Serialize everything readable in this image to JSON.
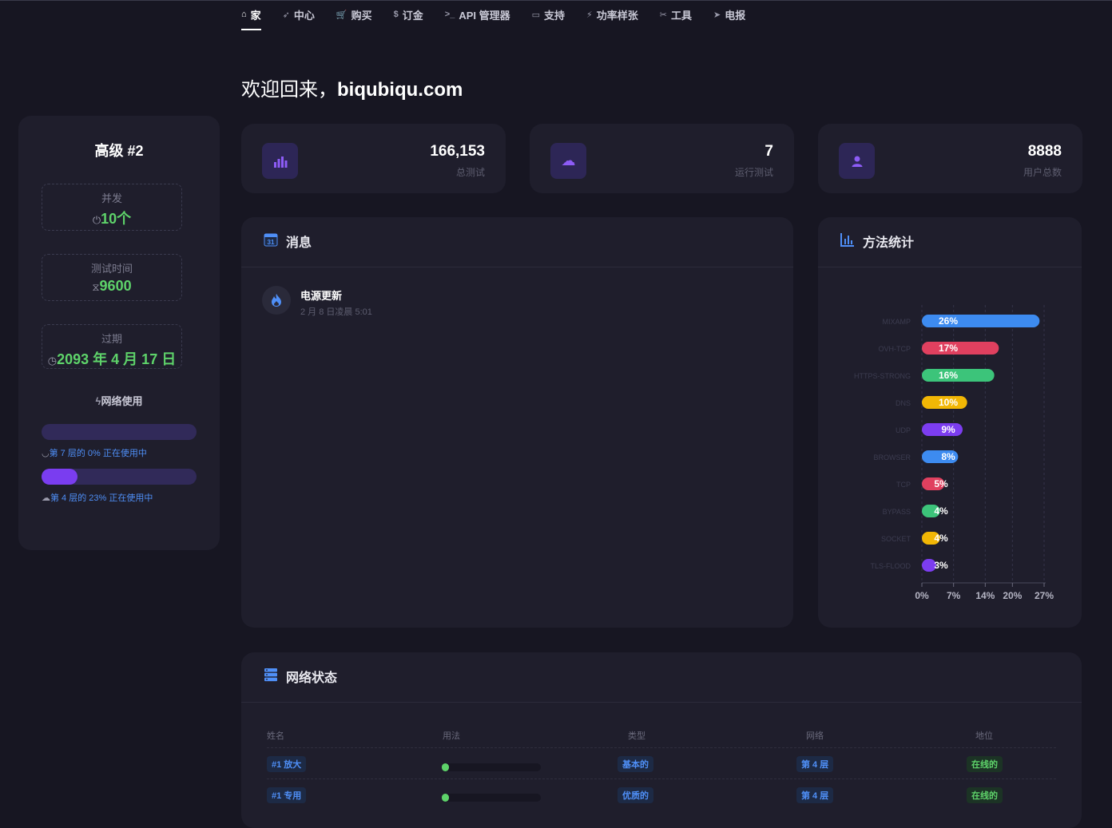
{
  "nav": {
    "items": [
      {
        "icon": "⌂",
        "label": "家"
      },
      {
        "icon": "➶",
        "label": "中心"
      },
      {
        "icon": "🛒",
        "label": "购买"
      },
      {
        "icon": "$",
        "label": "订金"
      },
      {
        "icon": ">_",
        "label": "API 管理器"
      },
      {
        "icon": "▭",
        "label": "支持"
      },
      {
        "icon": "⚡",
        "label": "功率样张"
      },
      {
        "icon": "✂",
        "label": "工具"
      },
      {
        "icon": "➤",
        "label": "电报"
      }
    ]
  },
  "welcome": {
    "prefix": "欢迎回来，",
    "user": "biqubiqu.com"
  },
  "sidebar": {
    "title": "高级 #2",
    "concurrent": {
      "label": "并发",
      "icon": "⏻",
      "value": "10个"
    },
    "test_time": {
      "label": "测试时间",
      "icon": "⧖",
      "value": "9600"
    },
    "expiry": {
      "label": "过期",
      "icon": "◷",
      "value": "2093 年 4 月 17 日"
    },
    "network_title": {
      "icon": "ϟ",
      "label": "网络使用"
    },
    "usage": [
      {
        "icon": "◡",
        "caption": "第 7 层的 0% 正在使用中",
        "percent": 0
      },
      {
        "icon": "☁",
        "caption": "第 4 层的 23% 正在使用中",
        "percent": 23
      }
    ]
  },
  "stats": [
    {
      "icon": "▮▮▮",
      "value": "166,153",
      "label": "总测试"
    },
    {
      "icon": "☁",
      "value": "7",
      "label": "运行测试"
    },
    {
      "icon": "●",
      "value": "8888",
      "label": "用户总数"
    }
  ],
  "messages": {
    "title": "消息",
    "items": [
      {
        "title": "电源更新",
        "time": "2 月 8 日凌晨 5:01"
      }
    ]
  },
  "chart_data": {
    "type": "bar",
    "title": "方法统计",
    "orientation": "horizontal",
    "categories": [
      "MIXAMP",
      "OVH-TCP",
      "HTTPS-STRONG",
      "DNS",
      "UDP",
      "BROWSER",
      "TCP",
      "BYPASS",
      "SOCKET",
      "TLS-FLOOD"
    ],
    "values": [
      26,
      17,
      16,
      10,
      9,
      8,
      5,
      4,
      4,
      3
    ],
    "labels": [
      "26%",
      "17%",
      "16%",
      "10%",
      "9%",
      "8%",
      "5%",
      "4%",
      "4%",
      "3%"
    ],
    "colors": [
      "#3d8bf0",
      "#e0405f",
      "#3cc47a",
      "#f2b705",
      "#7c3df0",
      "#3d8bf0",
      "#e0405f",
      "#3cc47a",
      "#f2b705",
      "#7c3df0"
    ],
    "xticks": [
      "0%",
      "7%",
      "14%",
      "20%",
      "27%"
    ],
    "xlim": [
      0,
      27
    ]
  },
  "network": {
    "title": "网络状态",
    "columns": [
      "姓名",
      "用法",
      "类型",
      "网络",
      "地位"
    ],
    "rows": [
      {
        "name": "#1 放大",
        "usage": 5,
        "type": "基本的",
        "net": "第 4 层",
        "status": "在线的"
      },
      {
        "name": "#1 专用",
        "usage": 5,
        "type": "优质的",
        "net": "第 4 层",
        "status": "在线的"
      }
    ]
  }
}
